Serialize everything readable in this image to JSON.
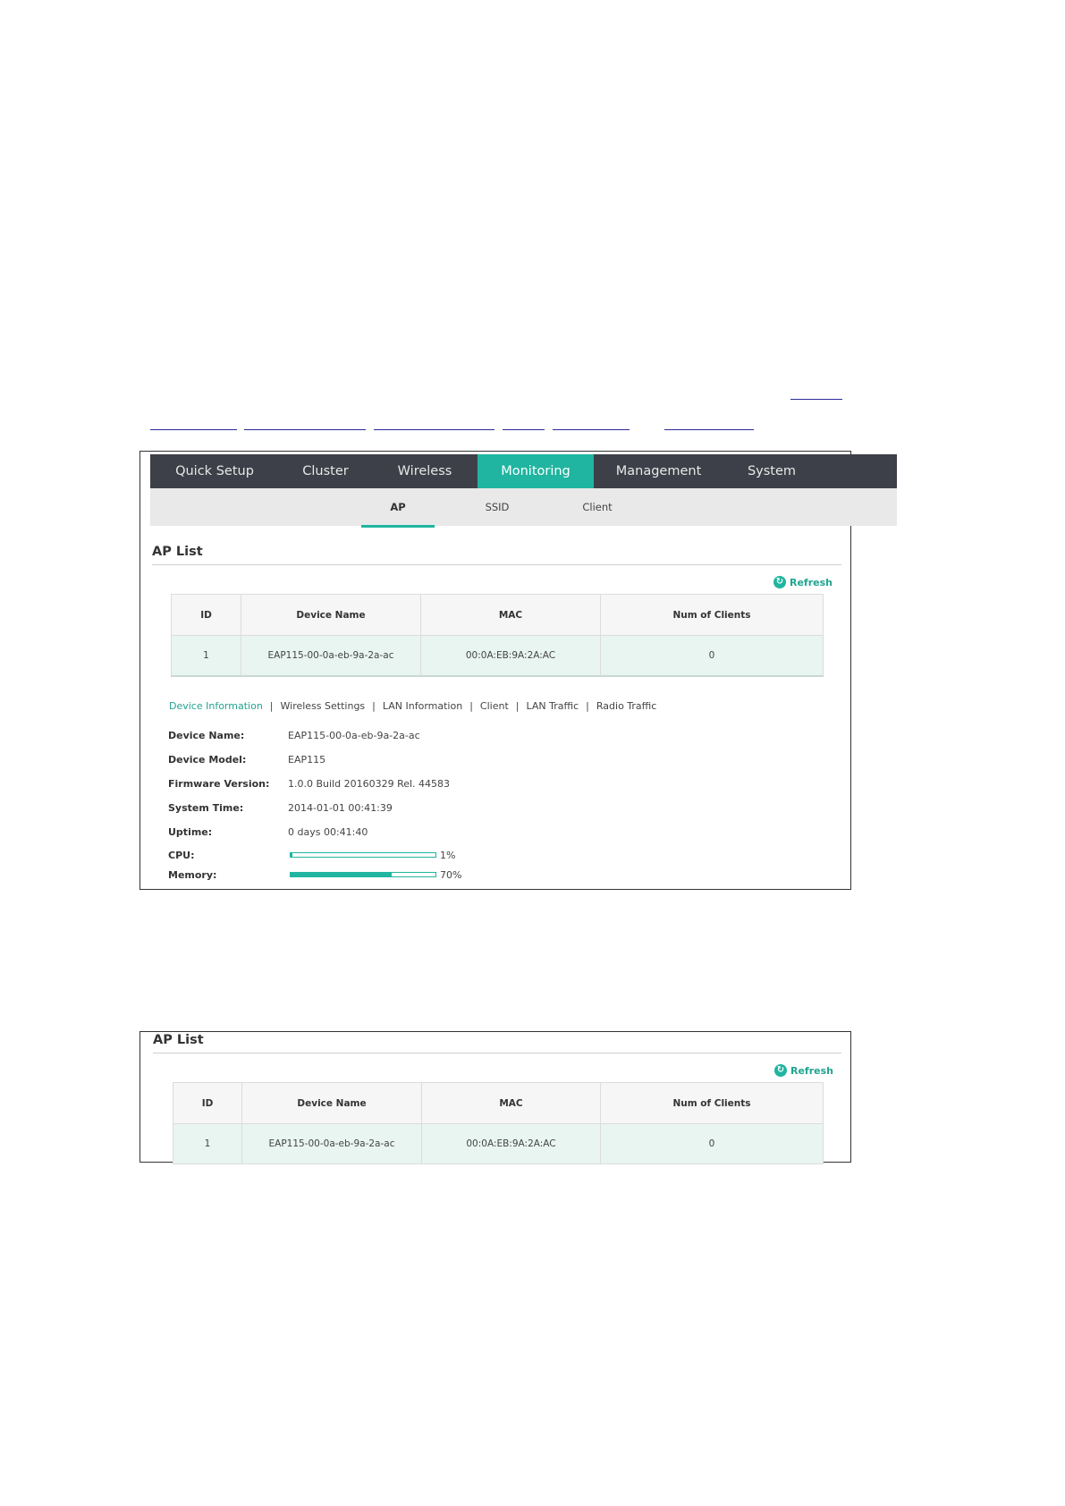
{
  "nav": {
    "tabs": [
      {
        "label": "Quick Setup"
      },
      {
        "label": "Cluster"
      },
      {
        "label": "Wireless"
      },
      {
        "label": "Monitoring",
        "active": true
      },
      {
        "label": "Management"
      },
      {
        "label": "System"
      }
    ],
    "subtabs": [
      {
        "label": "AP",
        "active": true
      },
      {
        "label": "SSID"
      },
      {
        "label": "Client"
      }
    ]
  },
  "ap_list": {
    "title": "AP List",
    "refresh_label": "Refresh",
    "columns": [
      "ID",
      "Device Name",
      "MAC",
      "Num of Clients"
    ],
    "rows": [
      {
        "id": "1",
        "device_name": "EAP115-00-0a-eb-9a-2a-ac",
        "mac": "00:0A:EB:9A:2A:AC",
        "num_clients": "0"
      }
    ]
  },
  "info_tabs": [
    "Device Information",
    "Wireless Settings",
    "LAN Information",
    "Client",
    "LAN Traffic",
    "Radio Traffic"
  ],
  "device_info": {
    "device_name_label": "Device Name:",
    "device_name": "EAP115-00-0a-eb-9a-2a-ac",
    "device_model_label": "Device Model:",
    "device_model": "EAP115",
    "firmware_label": "Firmware Version:",
    "firmware": "1.0.0 Build 20160329 Rel. 44583",
    "system_time_label": "System Time:",
    "system_time": "2014-01-01 00:41:39",
    "uptime_label": "Uptime:",
    "uptime": "0 days 00:41:40",
    "cpu_label": "CPU:",
    "cpu_percent": 1,
    "cpu_text": "1%",
    "memory_label": "Memory:",
    "memory_percent": 70,
    "memory_text": "70%"
  },
  "ap_list_2": {
    "title": "AP List",
    "refresh_label": "Refresh",
    "columns": [
      "ID",
      "Device Name",
      "MAC",
      "Num of Clients"
    ],
    "rows": [
      {
        "id": "1",
        "device_name": "EAP115-00-0a-eb-9a-2a-ac",
        "mac": "00:0A:EB:9A:2A:AC",
        "num_clients": "0"
      }
    ]
  },
  "colors": {
    "accent": "#20b5a0",
    "nav_bg": "#3d4048",
    "link": "#2a2a9a"
  }
}
